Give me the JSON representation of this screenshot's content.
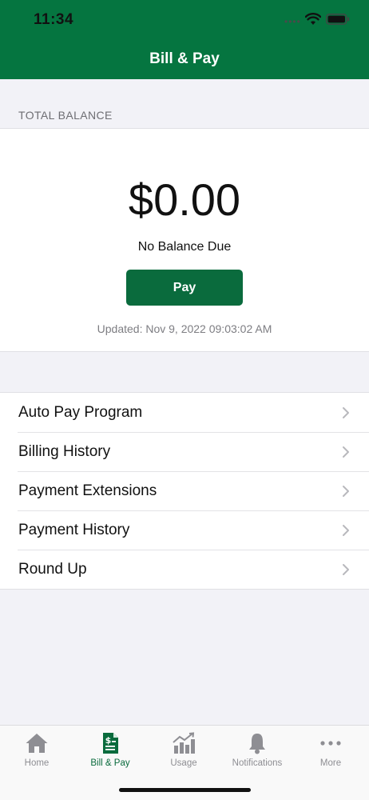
{
  "status_bar": {
    "time": "11:34"
  },
  "header": {
    "title": "Bill & Pay"
  },
  "balance": {
    "section_label": "TOTAL BALANCE",
    "amount": "$0.00",
    "status": "No Balance Due",
    "pay_label": "Pay",
    "updated": "Updated: Nov 9, 2022 09:03:02 AM"
  },
  "menu": {
    "items": [
      {
        "label": "Auto Pay Program"
      },
      {
        "label": "Billing History"
      },
      {
        "label": "Payment Extensions"
      },
      {
        "label": "Payment History"
      },
      {
        "label": "Round Up"
      }
    ]
  },
  "tabbar": {
    "tabs": [
      {
        "label": "Home",
        "icon": "home-icon"
      },
      {
        "label": "Bill & Pay",
        "icon": "bill-icon",
        "active": true
      },
      {
        "label": "Usage",
        "icon": "usage-chart-icon"
      },
      {
        "label": "Notifications",
        "icon": "bell-icon"
      },
      {
        "label": "More",
        "icon": "more-dots-icon"
      }
    ]
  },
  "colors": {
    "brand_green": "#057540",
    "button_green": "#0a6b3d",
    "background": "#f2f2f7",
    "inactive_tab": "#8e8e93"
  }
}
